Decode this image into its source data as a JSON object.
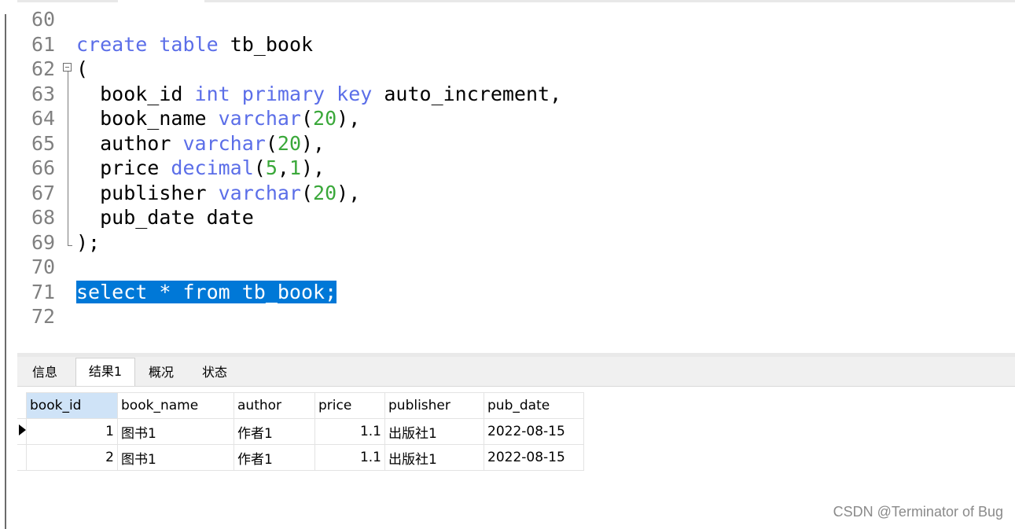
{
  "editor": {
    "lines": [
      {
        "num": "60",
        "parts": []
      },
      {
        "num": "61",
        "parts": [
          {
            "t": "create",
            "c": "kw"
          },
          {
            "t": " ",
            "c": ""
          },
          {
            "t": "table",
            "c": "kw"
          },
          {
            "t": " tb_book",
            "c": ""
          }
        ]
      },
      {
        "num": "62",
        "fold": "start",
        "parts": [
          {
            "t": "(",
            "c": ""
          }
        ]
      },
      {
        "num": "63",
        "parts": [
          {
            "t": "  book_id ",
            "c": ""
          },
          {
            "t": "int",
            "c": "kw"
          },
          {
            "t": " ",
            "c": ""
          },
          {
            "t": "primary",
            "c": "kw"
          },
          {
            "t": " ",
            "c": ""
          },
          {
            "t": "key",
            "c": "kw"
          },
          {
            "t": " auto_increment,",
            "c": ""
          }
        ]
      },
      {
        "num": "64",
        "parts": [
          {
            "t": "  book_name ",
            "c": ""
          },
          {
            "t": "varchar",
            "c": "kw"
          },
          {
            "t": "(",
            "c": ""
          },
          {
            "t": "20",
            "c": "num"
          },
          {
            "t": "),",
            "c": ""
          }
        ]
      },
      {
        "num": "65",
        "parts": [
          {
            "t": "  author ",
            "c": ""
          },
          {
            "t": "varchar",
            "c": "kw"
          },
          {
            "t": "(",
            "c": ""
          },
          {
            "t": "20",
            "c": "num"
          },
          {
            "t": "),",
            "c": ""
          }
        ]
      },
      {
        "num": "66",
        "parts": [
          {
            "t": "  price ",
            "c": ""
          },
          {
            "t": "decimal",
            "c": "kw"
          },
          {
            "t": "(",
            "c": ""
          },
          {
            "t": "5",
            "c": "num"
          },
          {
            "t": ",",
            "c": ""
          },
          {
            "t": "1",
            "c": "num"
          },
          {
            "t": "),",
            "c": ""
          }
        ]
      },
      {
        "num": "67",
        "parts": [
          {
            "t": "  publisher ",
            "c": ""
          },
          {
            "t": "varchar",
            "c": "kw"
          },
          {
            "t": "(",
            "c": ""
          },
          {
            "t": "20",
            "c": "num"
          },
          {
            "t": "),",
            "c": ""
          }
        ]
      },
      {
        "num": "68",
        "parts": [
          {
            "t": "  pub_date date",
            "c": ""
          }
        ]
      },
      {
        "num": "69",
        "fold": "end",
        "parts": [
          {
            "t": ");",
            "c": ""
          }
        ]
      },
      {
        "num": "70",
        "parts": []
      },
      {
        "num": "71",
        "parts": [
          {
            "t": "select * from tb_book;",
            "c": "selected"
          }
        ]
      },
      {
        "num": "72",
        "parts": []
      }
    ]
  },
  "result_tabs": [
    "信息",
    "结果1",
    "概况",
    "状态"
  ],
  "active_tab": "结果1",
  "grid": {
    "columns": [
      "book_id",
      "book_name",
      "author",
      "price",
      "publisher",
      "pub_date"
    ],
    "rows": [
      [
        "1",
        "图书1",
        "作者1",
        "1.1",
        "出版社1",
        "2022-08-15"
      ],
      [
        "2",
        "图书1",
        "作者1",
        "1.1",
        "出版社1",
        "2022-08-15"
      ]
    ]
  },
  "watermark": "CSDN @Terminator of Bug"
}
